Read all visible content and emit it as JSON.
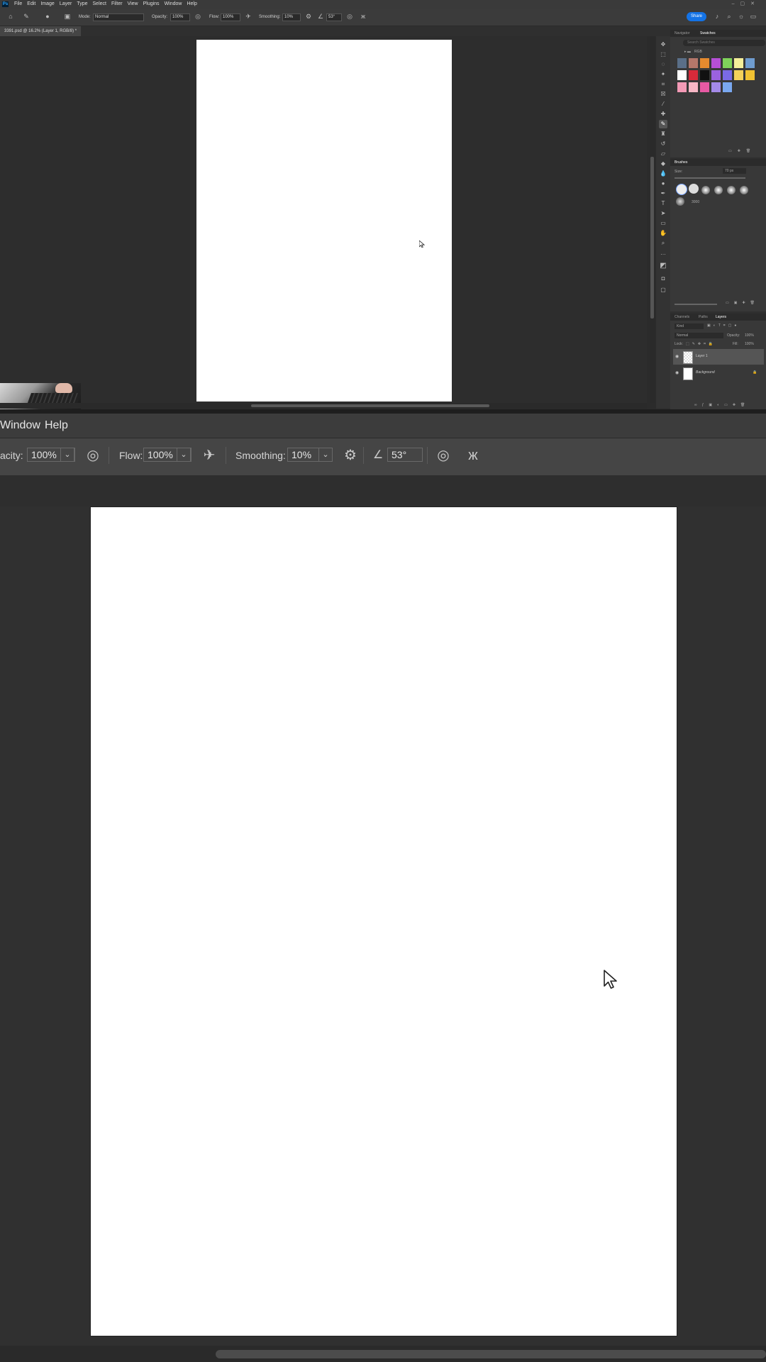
{
  "top": {
    "app_icon": "Ps",
    "menu": [
      "File",
      "Edit",
      "Image",
      "Layer",
      "Type",
      "Select",
      "Filter",
      "View",
      "Plugins",
      "Window",
      "Help"
    ],
    "options": {
      "mode_label": "Mode:",
      "mode_value": "Normal",
      "opacity_label": "Opacity:",
      "opacity_value": "100%",
      "flow_label": "Flow:",
      "flow_value": "100%",
      "smoothing_label": "Smoothing:",
      "smoothing_value": "10%",
      "angle_value": "53°",
      "share_label": "Share"
    },
    "doc_tab": "3391.psd @ 16.2% (Layer 1, RGB/8) *",
    "panels": {
      "color_tabs": [
        "Navigator",
        "Swatches"
      ],
      "swatch_search_placeholder": "Search Swatches",
      "swatch_group": "RGB",
      "swatches": [
        "#5a6f88",
        "#b4776a",
        "#e58a2e",
        "#b64fd6",
        "#7fd35a",
        "#f4ef9a",
        "#6f9ccf",
        "#ffffff",
        "#d92a3a",
        "#111111",
        "#9b62e0",
        "#7a6ae6",
        "#f4d15a",
        "#f1c232",
        "#f49ab6",
        "#f7b7c5",
        "#e75aa3",
        "#a48ae8",
        "#7aa8f0"
      ],
      "brushes_title": "Brushes",
      "size_label": "Size:",
      "size_value": "70 px",
      "brush_count": "3000",
      "layers_tabs": [
        "Channels",
        "Paths",
        "Layers"
      ],
      "layers_kind": "Kind",
      "blend_mode": "Normal",
      "opacity_label": "Opacity:",
      "opacity_value": "100%",
      "lock_label": "Lock:",
      "fill_label": "Fill:",
      "fill_value": "100%",
      "layers": [
        "Layer 1",
        "Background"
      ]
    }
  },
  "zoom": {
    "menu": [
      "Window",
      "Help"
    ],
    "options": {
      "opacity_label": "acity:",
      "opacity_value": "100%",
      "flow_label": "Flow:",
      "flow_value": "100%",
      "smoothing_label": "Smoothing:",
      "smoothing_value": "10%",
      "angle_value": "53°"
    }
  },
  "icons": {
    "chevron": "⌄",
    "cursor": "arrow-pointer"
  }
}
